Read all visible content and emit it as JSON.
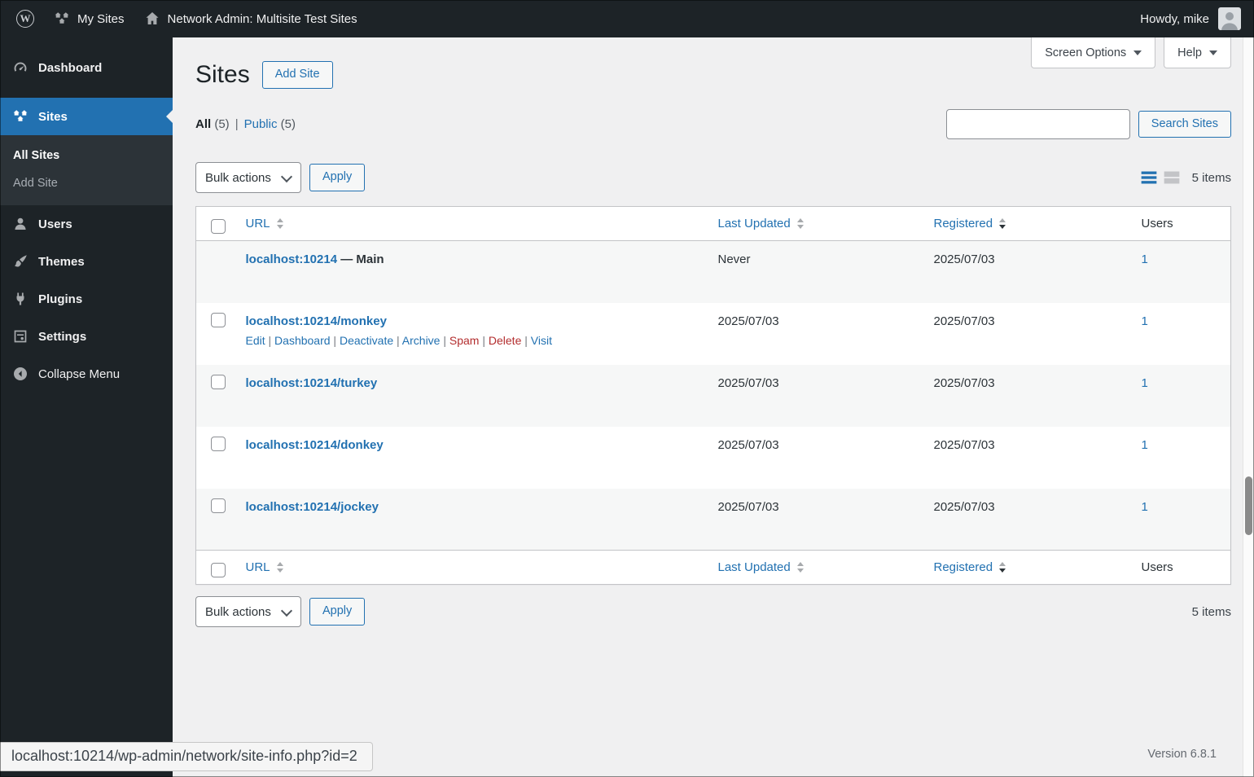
{
  "admin_bar": {
    "my_sites_label": "My Sites",
    "site_label": "Network Admin: Multisite Test Sites",
    "howdy": "Howdy, mike"
  },
  "sidebar": {
    "items": [
      {
        "label": "Dashboard"
      },
      {
        "label": "Sites"
      },
      {
        "label": "Users"
      },
      {
        "label": "Themes"
      },
      {
        "label": "Plugins"
      },
      {
        "label": "Settings"
      },
      {
        "label": "Collapse Menu"
      }
    ],
    "sites_submenu": [
      {
        "label": "All Sites"
      },
      {
        "label": "Add Site"
      }
    ]
  },
  "page": {
    "title": "Sites",
    "add_site_button": "Add Site",
    "screen_options": "Screen Options",
    "help": "Help"
  },
  "filters": {
    "all_label": "All",
    "all_count": "(5)",
    "separator": "|",
    "public_label": "Public",
    "public_count": "(5)"
  },
  "search": {
    "value": "",
    "button": "Search Sites"
  },
  "tablenav": {
    "bulk_actions_label": "Bulk actions",
    "apply_button": "Apply",
    "items_count": "5 items"
  },
  "table": {
    "headers": {
      "url": "URL",
      "last_updated": "Last Updated",
      "registered": "Registered",
      "users": "Users"
    },
    "sorted_column": "registered",
    "sort_order": "desc",
    "rows": [
      {
        "url": "localhost:10214",
        "suffix": "— Main",
        "is_main": true,
        "last_updated": "Never",
        "registered": "2025/07/03",
        "users": "1",
        "actions": [],
        "actions_visible": false
      },
      {
        "url": "localhost:10214/monkey",
        "is_main": false,
        "last_updated": "2025/07/03",
        "registered": "2025/07/03",
        "users": "1",
        "actions_visible": true,
        "actions": [
          {
            "label": "Edit",
            "danger": false
          },
          {
            "label": "Dashboard",
            "danger": false
          },
          {
            "label": "Deactivate",
            "danger": false
          },
          {
            "label": "Archive",
            "danger": false
          },
          {
            "label": "Spam",
            "danger": true
          },
          {
            "label": "Delete",
            "danger": true
          },
          {
            "label": "Visit",
            "danger": false
          }
        ]
      },
      {
        "url": "localhost:10214/turkey",
        "is_main": false,
        "last_updated": "2025/07/03",
        "registered": "2025/07/03",
        "users": "1",
        "actions": [],
        "actions_visible": false
      },
      {
        "url": "localhost:10214/donkey",
        "is_main": false,
        "last_updated": "2025/07/03",
        "registered": "2025/07/03",
        "users": "1",
        "actions": [],
        "actions_visible": false
      },
      {
        "url": "localhost:10214/jockey",
        "is_main": false,
        "last_updated": "2025/07/03",
        "registered": "2025/07/03",
        "users": "1",
        "actions": [],
        "actions_visible": false
      }
    ]
  },
  "footer": {
    "version": "Version 6.8.1"
  },
  "status_bar": {
    "link_preview": "localhost:10214/wp-admin/network/site-info.php?id=2"
  },
  "colors": {
    "accent": "#2271b1",
    "danger": "#b32d2e",
    "admin_bar_bg": "#1d2327",
    "submenu_bg": "#2c3338",
    "content_bg": "#f0f0f1",
    "table_stripe": "#f6f7f7"
  },
  "icons": {
    "wordpress_logo_glyph": "W",
    "my_sites_icon": "multisite-houses",
    "network_home_icon": "house",
    "dashboard_icon": "gauge",
    "sites_icon": "multisite-houses",
    "users_icon": "person",
    "themes_icon": "paintbrush",
    "plugins_icon": "plug",
    "settings_icon": "control-panel",
    "collapse_icon": "circled-left-arrow",
    "caret": "▼",
    "sort_arrows": "▲▼",
    "list_view_icon": "rows",
    "excerpt_view_icon": "blocks"
  }
}
